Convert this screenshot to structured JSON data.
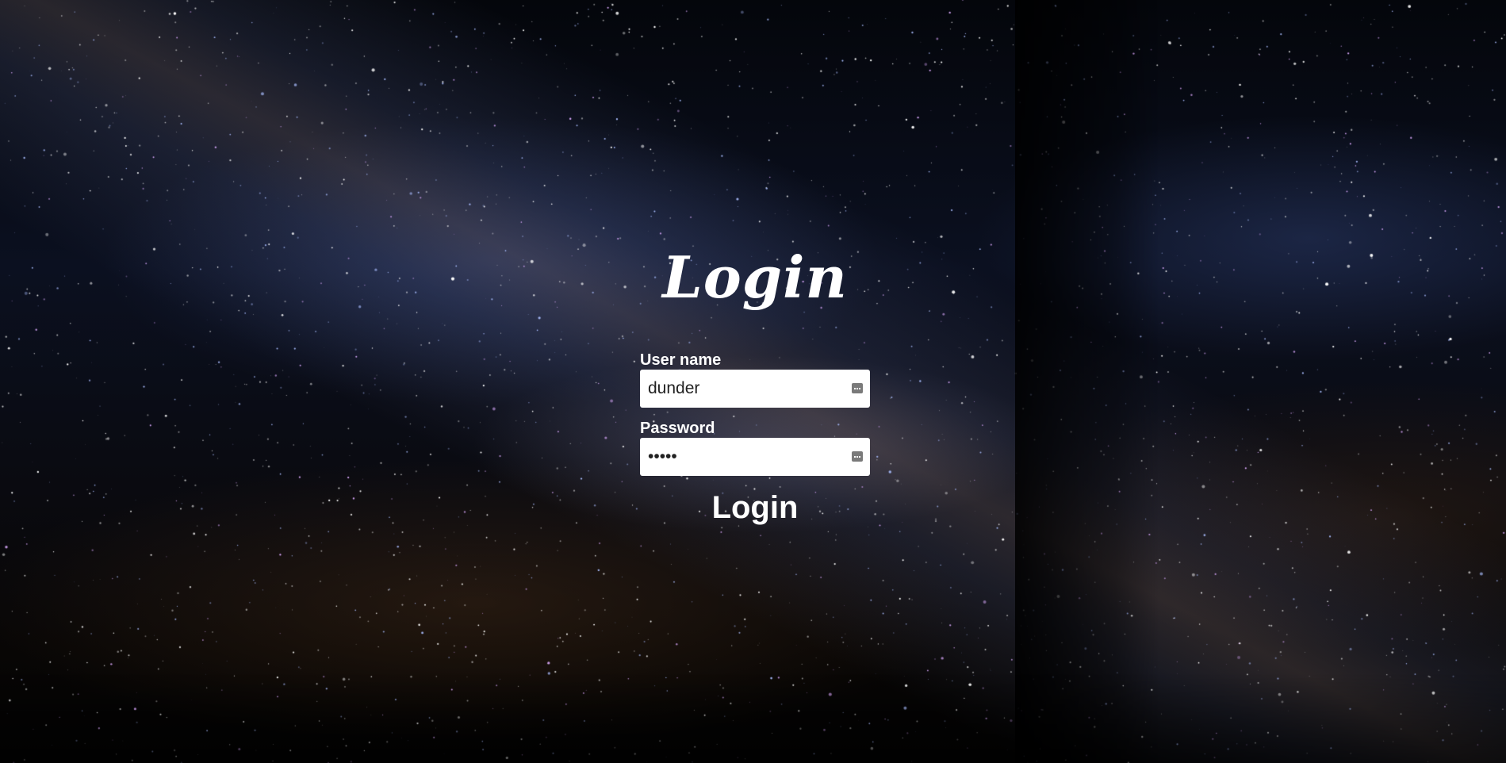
{
  "page": {
    "title": "Login",
    "background": "starry night sky"
  },
  "form": {
    "username_label": "User name",
    "username_value": "dunder",
    "password_label": "Password",
    "password_value": "•••••",
    "submit_label": "Login",
    "field_icon": "password-manager-icon"
  }
}
